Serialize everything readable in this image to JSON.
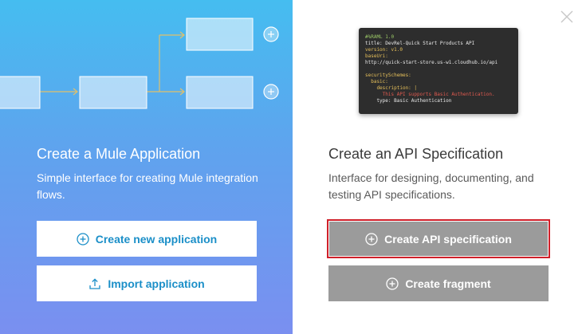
{
  "mule": {
    "title": "Create a Mule Application",
    "description": "Simple interface for creating Mule integration flows.",
    "create_label": "Create new application",
    "import_label": "Import application"
  },
  "api": {
    "title": "Create an API Specification",
    "description": "Interface for designing, documenting, and testing API specifications.",
    "create_label": "Create API specification",
    "fragment_label": "Create fragment",
    "code_lines": [
      {
        "text": "#%RAML 1.0",
        "tone": "green"
      },
      {
        "text": "title: DevRel-Quick Start Products API",
        "tone": "white"
      },
      {
        "text": "version: v1.0",
        "tone": "yellow"
      },
      {
        "text": "baseUri:",
        "tone": "yellow"
      },
      {
        "text": "http://quick-start-store.us-w1.cloudhub.io/api",
        "tone": "white"
      },
      {
        "text": "",
        "tone": "white"
      },
      {
        "text": "securitySchemes:",
        "tone": "yellow"
      },
      {
        "text": "  basic:",
        "tone": "yellow"
      },
      {
        "text": "    description: |",
        "tone": "yellow"
      },
      {
        "text": "      This API supports Basic Authentication.",
        "tone": "red"
      },
      {
        "text": "    type: Basic Authentication",
        "tone": "white"
      }
    ]
  },
  "colors": {
    "accent_blue": "#1b8fc8",
    "selected_outline": "#d0202a",
    "grey_button": "#9b9b9b"
  },
  "icons": {
    "close": "close-icon",
    "plus_circle": "plus-circle-icon",
    "upload": "upload-icon"
  }
}
